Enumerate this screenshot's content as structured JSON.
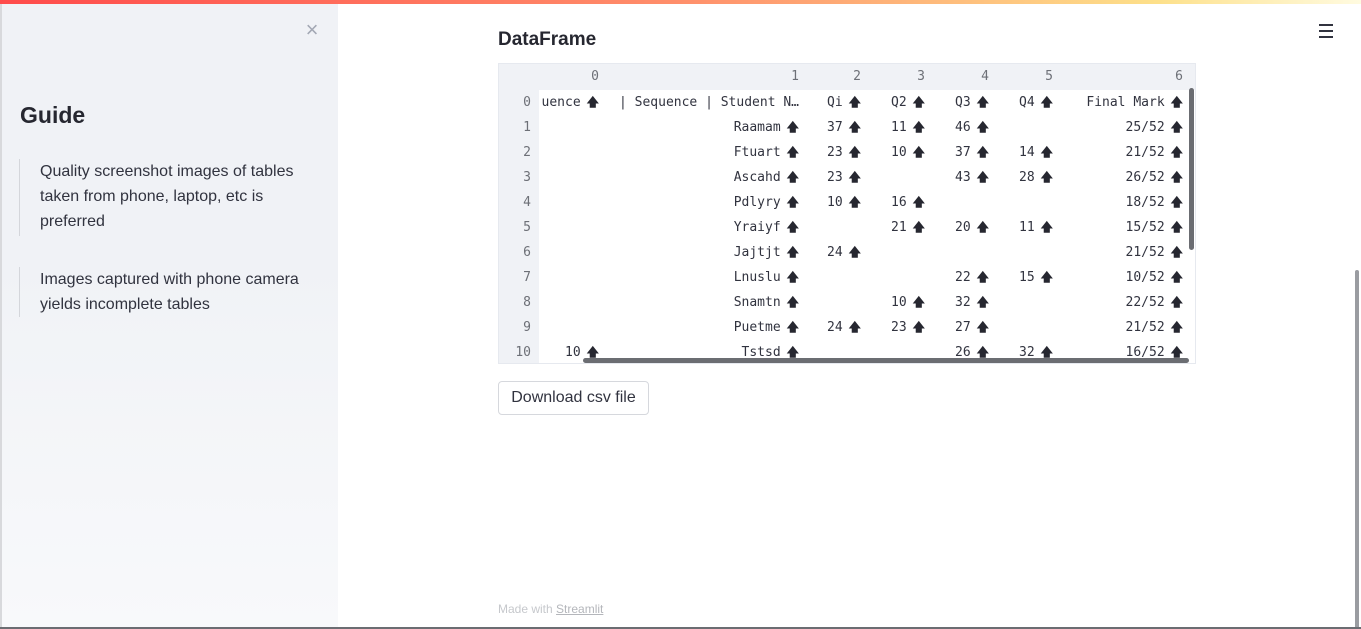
{
  "sidebar": {
    "close_glyph": "×",
    "title": "Guide",
    "items": [
      {
        "text": "Quality screenshot images of tables taken from phone, laptop, etc is preferred"
      },
      {
        "text": "Images captured with phone camera yields incomplete tables"
      }
    ]
  },
  "main": {
    "title": "DataFrame",
    "download_label": "Download csv file"
  },
  "dataframe": {
    "column_headers": [
      "0",
      "1",
      "2",
      "3",
      "4",
      "5",
      "6"
    ],
    "sort_icon": "arrow-up-icon",
    "rows": [
      {
        "index": "0",
        "c0": "uence",
        "c1": "| Sequence | Student N…",
        "c2": "Qi",
        "c3": "Q2",
        "c4": "Q3",
        "c5": "Q4",
        "c6": "Final Mark"
      },
      {
        "index": "1",
        "c0": "",
        "c1": "Raamam",
        "c2": "37",
        "c3": "11",
        "c4": "46",
        "c5": "",
        "c6": "25/52"
      },
      {
        "index": "2",
        "c0": "",
        "c1": "Ftuart",
        "c2": "23",
        "c3": "10",
        "c4": "37",
        "c5": "14",
        "c6": "21/52"
      },
      {
        "index": "3",
        "c0": "",
        "c1": "Ascahd",
        "c2": "23",
        "c3": "",
        "c4": "43",
        "c5": "28",
        "c6": "26/52"
      },
      {
        "index": "4",
        "c0": "",
        "c1": "Pdlyry",
        "c2": "10",
        "c3": "16",
        "c4": "",
        "c5": "",
        "c6": "18/52"
      },
      {
        "index": "5",
        "c0": "",
        "c1": "Yraiyf",
        "c2": "",
        "c3": "21",
        "c4": "20",
        "c5": "11",
        "c6": "15/52"
      },
      {
        "index": "6",
        "c0": "",
        "c1": "Jajtjt",
        "c2": "24",
        "c3": "",
        "c4": "",
        "c5": "",
        "c6": "21/52"
      },
      {
        "index": "7",
        "c0": "",
        "c1": "Lnuslu",
        "c2": "",
        "c3": "",
        "c4": "22",
        "c5": "15",
        "c6": "10/52"
      },
      {
        "index": "8",
        "c0": "",
        "c1": "Snamtn",
        "c2": "",
        "c3": "10",
        "c4": "32",
        "c5": "",
        "c6": "22/52"
      },
      {
        "index": "9",
        "c0": "",
        "c1": "Puetme",
        "c2": "24",
        "c3": "23",
        "c4": "27",
        "c5": "",
        "c6": "21/52"
      },
      {
        "index": "10",
        "c0": "10",
        "c1": "Tstsd",
        "c2": "",
        "c3": "",
        "c4": "26",
        "c5": "32",
        "c6": "16/52"
      }
    ]
  },
  "footer": {
    "prefix": "Made with",
    "link": "Streamlit"
  }
}
